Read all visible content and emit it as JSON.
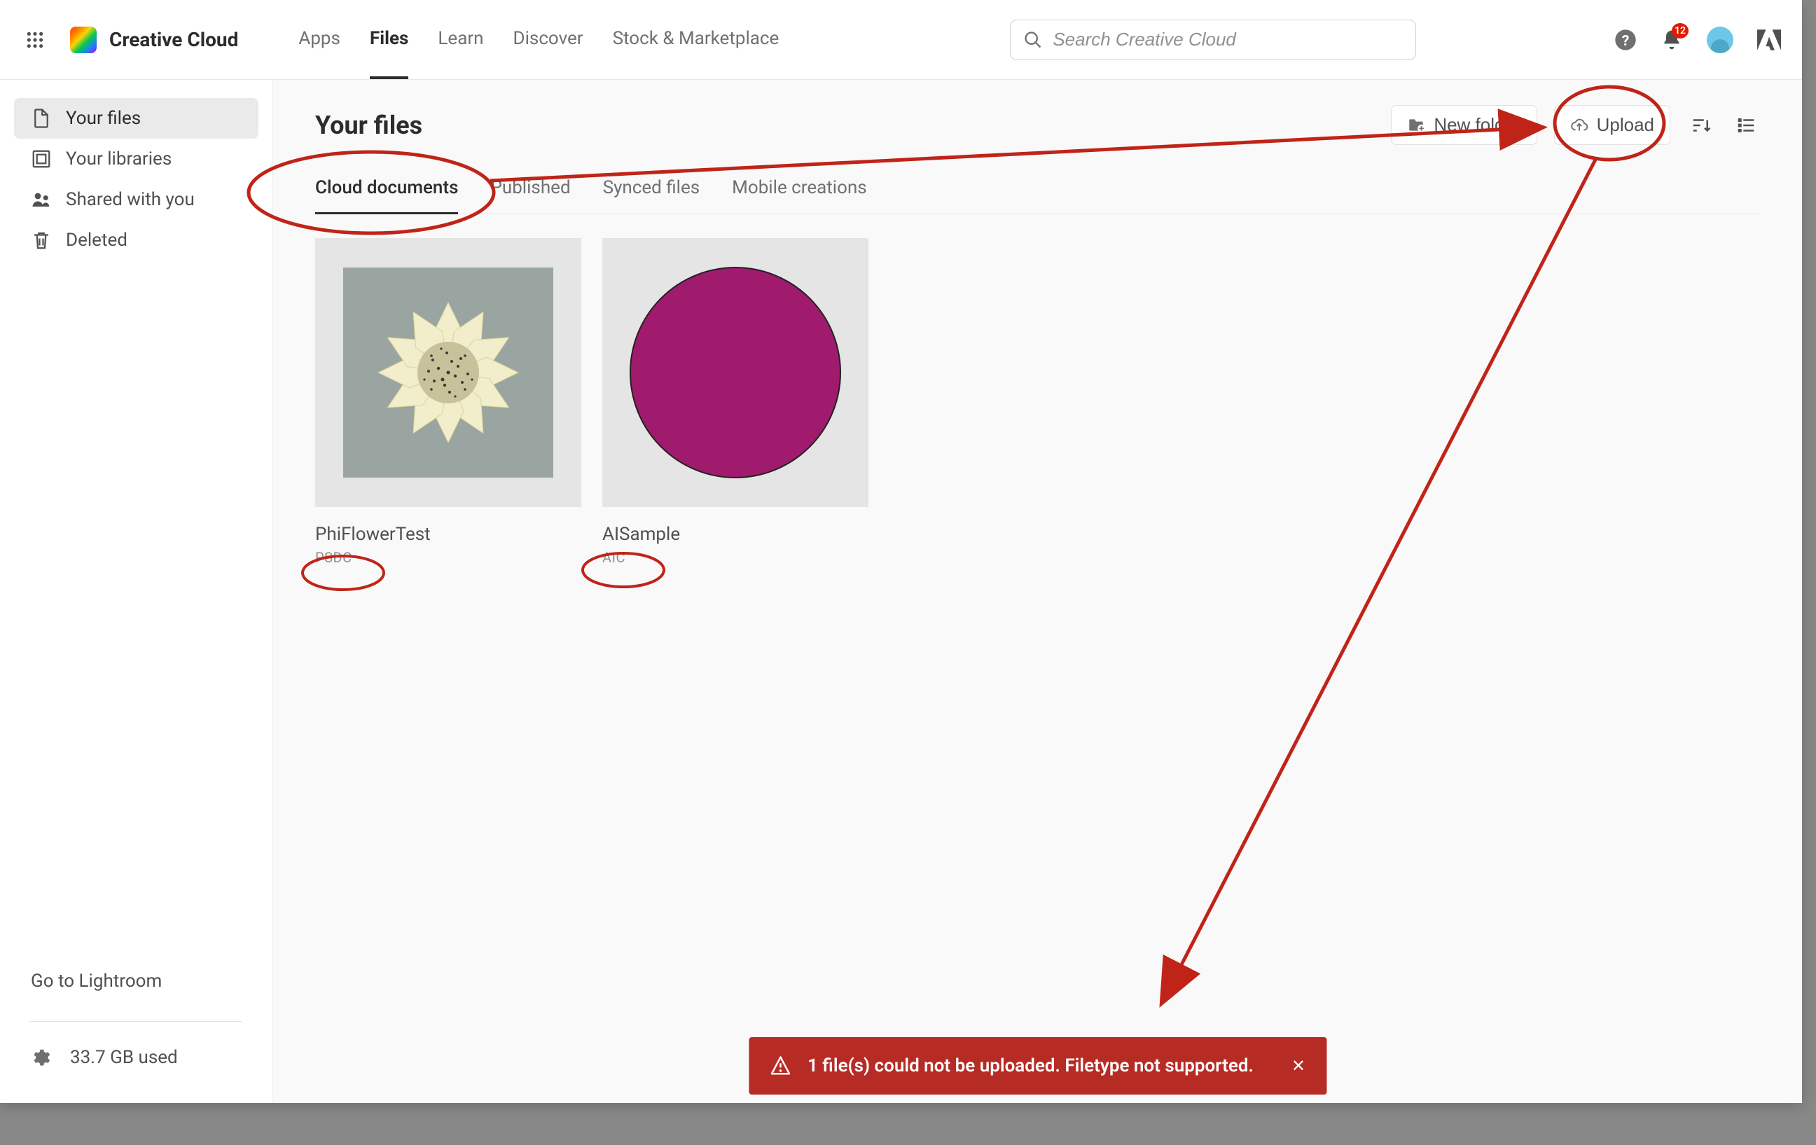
{
  "brand": "Creative Cloud",
  "topNav": {
    "items": [
      "Apps",
      "Files",
      "Learn",
      "Discover",
      "Stock & Marketplace"
    ],
    "activeIndex": 1
  },
  "search": {
    "placeholder": "Search Creative Cloud"
  },
  "notifications": {
    "count": "12"
  },
  "sidebar": {
    "items": [
      {
        "label": "Your files",
        "icon": "file"
      },
      {
        "label": "Your libraries",
        "icon": "libraries"
      },
      {
        "label": "Shared with you",
        "icon": "shared"
      },
      {
        "label": "Deleted",
        "icon": "trash"
      }
    ],
    "activeIndex": 0,
    "footerLink": "Go to Lightroom",
    "storage": "33.7 GB used"
  },
  "page": {
    "title": "Your files",
    "actions": {
      "newFolder": "New folder",
      "upload": "Upload"
    }
  },
  "tabs": {
    "items": [
      "Cloud documents",
      "Published",
      "Synced files",
      "Mobile creations"
    ],
    "activeIndex": 0
  },
  "files": [
    {
      "name": "PhiFlowerTest",
      "type": "PSDC",
      "thumb": "flower"
    },
    {
      "name": "AISample",
      "type": "AIC",
      "thumb": "circle"
    }
  ],
  "toast": {
    "message": "1 file(s) could not be uploaded. Filetype not supported."
  },
  "colors": {
    "accentPurple": "#a01a6d",
    "errorRed": "#b72b25",
    "annotationRed": "#c02418"
  }
}
